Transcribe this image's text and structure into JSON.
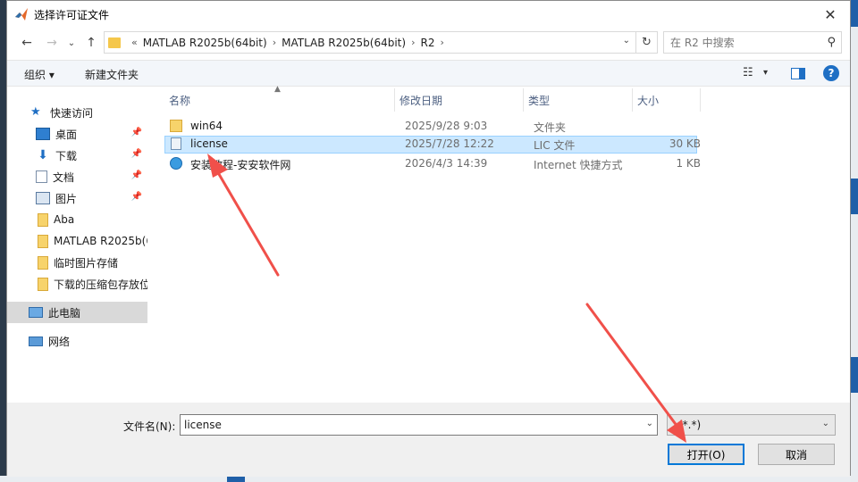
{
  "window": {
    "title": "选择许可证文件",
    "close_glyph": "✕"
  },
  "nav": {
    "back": "←",
    "forward": "→",
    "history": "⌄",
    "up": "↑"
  },
  "address": {
    "prefix": "«",
    "crumbs": [
      "MATLAB R2025b(64bit)",
      "MATLAB R2025b(64bit)",
      "R2"
    ],
    "dropdown": "⌄",
    "refresh": "↻"
  },
  "search": {
    "placeholder": "在 R2 中搜索"
  },
  "toolbar": {
    "organize": "组织 ▾",
    "new_folder": "新建文件夹",
    "view": "▾"
  },
  "sidebar": {
    "items": [
      {
        "label": "快速访问",
        "icon": "star-icon"
      },
      {
        "label": "桌面",
        "icon": "desktop-icon",
        "pinned": true
      },
      {
        "label": "下载",
        "icon": "download-icon",
        "pinned": true
      },
      {
        "label": "文档",
        "icon": "document-icon",
        "pinned": true
      },
      {
        "label": "图片",
        "icon": "picture-icon",
        "pinned": true
      },
      {
        "label": "Aba",
        "icon": "folder-icon"
      },
      {
        "label": "MATLAB R2025b(6",
        "icon": "folder-icon"
      },
      {
        "label": "临时图片存储",
        "icon": "folder-icon"
      },
      {
        "label": "下载的压缩包存放位",
        "icon": "folder-icon"
      },
      {
        "label": "此电脑",
        "icon": "computer-icon"
      },
      {
        "label": "网络",
        "icon": "network-icon"
      }
    ]
  },
  "columns": {
    "name": "名称",
    "date": "修改日期",
    "type": "类型",
    "size": "大小"
  },
  "files": [
    {
      "name": "win64",
      "date": "2025/9/28 9:03",
      "type": "文件夹",
      "size": "",
      "icon": "folder-icon"
    },
    {
      "name": "license",
      "date": "2025/7/28 12:22",
      "type": "LIC 文件",
      "size": "30 KB",
      "icon": "file-icon",
      "selected": true
    },
    {
      "name": "安装教程-安安软件网",
      "date": "2026/4/3 14:39",
      "type": "Internet 快捷方式",
      "size": "1 KB",
      "icon": "internet-shortcut-icon"
    }
  ],
  "filename": {
    "label": "文件名(N):",
    "value": "license"
  },
  "filetype": {
    "value": "(*.*)"
  },
  "buttons": {
    "open": "打开(O)",
    "cancel": "取消"
  },
  "colors": {
    "accent": "#0078d7",
    "selection": "#cce8ff",
    "annotation_arrow": "#f0504a"
  }
}
